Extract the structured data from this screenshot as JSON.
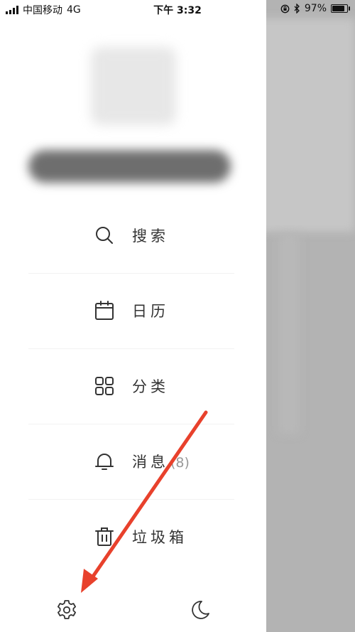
{
  "status_bar": {
    "carrier": "中国移动",
    "network": "4G",
    "time": "下午 3:32",
    "battery_percent": "97%",
    "battery_level": 0.97
  },
  "menu": {
    "items": [
      {
        "id": "search",
        "label": "搜索",
        "icon": "search-icon"
      },
      {
        "id": "calendar",
        "label": "日历",
        "icon": "calendar-icon"
      },
      {
        "id": "category",
        "label": "分类",
        "icon": "grid-icon"
      },
      {
        "id": "messages",
        "label": "消息",
        "badge": "(8)",
        "icon": "bell-icon"
      },
      {
        "id": "trash",
        "label": "垃圾箱",
        "icon": "trash-icon"
      }
    ]
  },
  "bottom_bar": {
    "settings_icon": "gear-icon",
    "night_mode_icon": "moon-icon"
  },
  "colors": {
    "annotation_arrow": "#e8412c",
    "overlay": "#b3b3b3",
    "icon_stroke": "#333333"
  }
}
